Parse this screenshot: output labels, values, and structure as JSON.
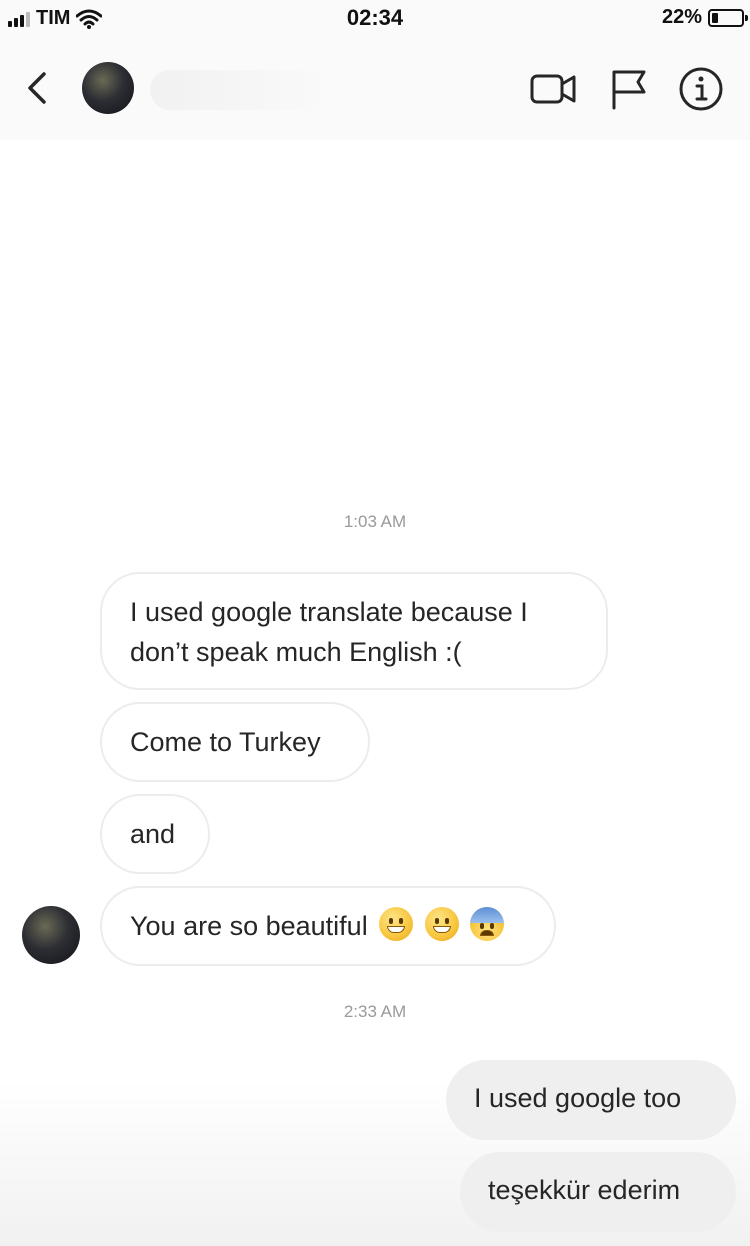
{
  "status_bar": {
    "carrier": "TIM",
    "time": "02:34",
    "battery_percent": "22%",
    "battery_level": 0.22,
    "icons": [
      "signal-icon",
      "wifi-icon",
      "battery-icon"
    ]
  },
  "header": {
    "icons": [
      "back-chevron-icon",
      "video-call-icon",
      "flag-icon",
      "info-icon"
    ]
  },
  "conversation": {
    "timestamps": [
      "1:03 AM",
      "2:33 AM"
    ],
    "incoming": [
      {
        "line1": "I used google translate because I",
        "line2": "don’t speak much English :("
      },
      {
        "text": "Come to Turkey"
      },
      {
        "text": "and"
      },
      {
        "text": "You are so beautiful",
        "emojis": [
          "grinning-face-icon",
          "grinning-face-icon",
          "anxious-face-icon"
        ]
      }
    ],
    "outgoing": [
      {
        "text": "I used google too"
      },
      {
        "text": "teşekkür ederim"
      }
    ]
  },
  "colors": {
    "incoming_bubble_border": "#ececec",
    "outgoing_bubble": "#efefef",
    "text": "#262626",
    "timestamp": "#9a9a9a"
  }
}
